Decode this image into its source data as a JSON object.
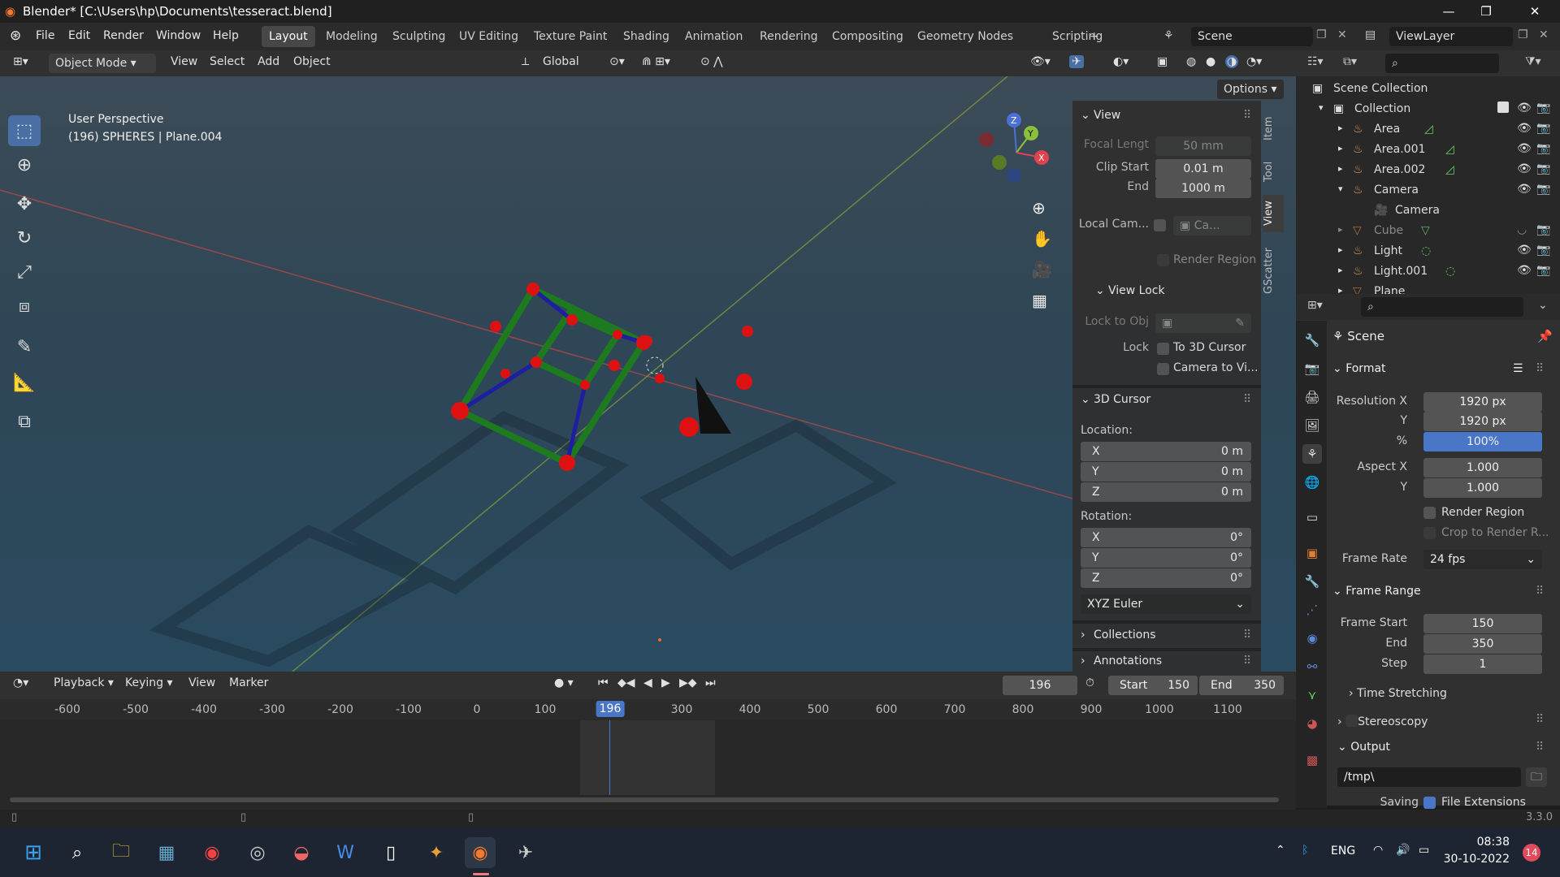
{
  "window": {
    "title": "Blender* [C:\\Users\\hp\\Documents\\tesseract.blend]"
  },
  "menu": {
    "items": [
      "File",
      "Edit",
      "Render",
      "Window",
      "Help"
    ]
  },
  "workspaces": [
    "Layout",
    "Modeling",
    "Sculpting",
    "UV Editing",
    "Texture Paint",
    "Shading",
    "Animation",
    "Rendering",
    "Compositing",
    "Geometry Nodes",
    "Scripting",
    "+"
  ],
  "scene": {
    "name": "Scene",
    "viewlayer": "ViewLayer"
  },
  "viewport_header": {
    "mode": "Object Mode",
    "view": "View",
    "select": "Select",
    "add": "Add",
    "object": "Object",
    "orientation": "Global",
    "options": "Options"
  },
  "viewport": {
    "perspective": "User Perspective",
    "object_info": "(196) SPHERES | Plane.004"
  },
  "npanel": {
    "view": {
      "title": "View",
      "focal_label": "Focal Lengt",
      "focal": "50 mm",
      "clip_start_label": "Clip Start",
      "clip_start": "0.01 m",
      "end_label": "End",
      "clip_end": "1000 m",
      "local_cam_label": "Local Cam...",
      "local_cam": "Ca...",
      "render_region": "Render Region"
    },
    "view_lock": {
      "title": "View Lock",
      "lock_obj_label": "Lock to Obj",
      "lock_label": "Lock",
      "to_cursor": "To 3D Cursor",
      "cam_to_view": "Camera to Vi..."
    },
    "cursor": {
      "title": "3D Cursor",
      "location": "Location:",
      "x": "X",
      "y": "Y",
      "z": "Z",
      "lx": "0 m",
      "ly": "0 m",
      "lz": "0 m",
      "rotation": "Rotation:",
      "rx": "0°",
      "ry": "0°",
      "rz": "0°",
      "mode": "XYZ Euler"
    },
    "collections": "Collections",
    "annotations": "Annotations"
  },
  "vtabs": [
    "Item",
    "Tool",
    "View",
    "GScatter"
  ],
  "outliner": {
    "root": "Scene Collection",
    "collection": "Collection",
    "items": [
      "Area",
      "Area.001",
      "Area.002",
      "Camera",
      "Camera",
      "Cube",
      "Light",
      "Light.001",
      "Plane"
    ]
  },
  "properties": {
    "context": "Scene",
    "format": "Format",
    "res_x_label": "Resolution X",
    "res_x": "1920 px",
    "res_y_label": "Y",
    "res_y": "1920 px",
    "pct_label": "%",
    "pct": "100%",
    "aspect_x_label": "Aspect X",
    "aspect_x": "1.000",
    "aspect_y_label": "Y",
    "aspect_y": "1.000",
    "render_region": "Render Region",
    "crop": "Crop to Render R...",
    "frame_rate_label": "Frame Rate",
    "frame_rate": "24 fps",
    "frame_range": "Frame Range",
    "start_label": "Frame Start",
    "start": "150",
    "end_label": "End",
    "end": "350",
    "step_label": "Step",
    "step": "1",
    "time_stretching": "Time Stretching",
    "stereoscopy": "Stereoscopy",
    "output": "Output",
    "path": "/tmp\\",
    "saving": "Saving",
    "file_ext": "File Extensions"
  },
  "timeline": {
    "playback": "Playback",
    "keying": "Keying",
    "view": "View",
    "marker": "Marker",
    "current": "196",
    "start_label": "Start",
    "start": "150",
    "end_label": "End",
    "end": "350",
    "ticks": [
      "-600",
      "-500",
      "-400",
      "-300",
      "-200",
      "-100",
      "0",
      "100",
      "196",
      "300",
      "400",
      "500",
      "600",
      "700",
      "800",
      "900",
      "1000",
      "1100"
    ]
  },
  "status": {
    "version": "3.3.0"
  },
  "taskbar": {
    "lang": "ENG",
    "time": "08:38",
    "date": "30-10-2022",
    "badge": "14"
  }
}
